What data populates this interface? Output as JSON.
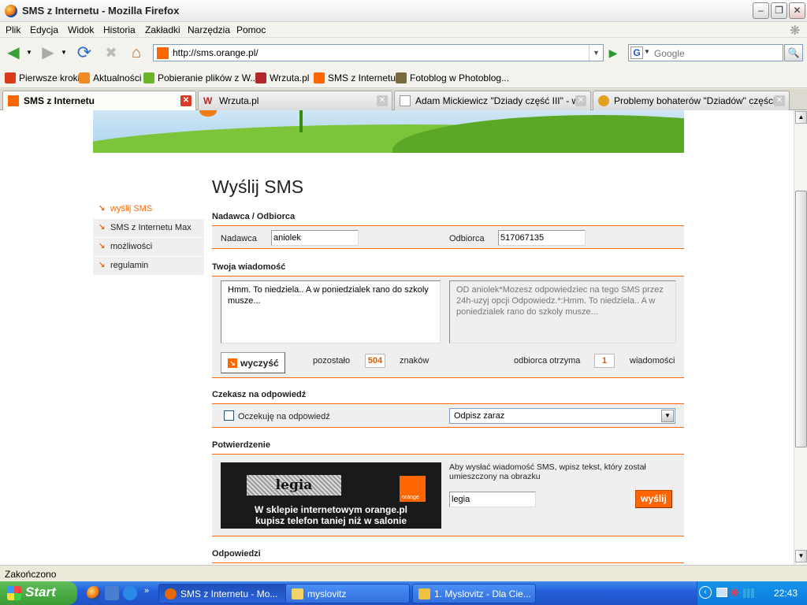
{
  "window": {
    "title": "SMS z Internetu - Mozilla Firefox"
  },
  "menu": [
    "Plik",
    "Edycja",
    "Widok",
    "Historia",
    "Zakładki",
    "Narzędzia",
    "Pomoc"
  ],
  "nav": {
    "url": "http://sms.orange.pl/",
    "search_placeholder": "Google"
  },
  "bookmarks": [
    {
      "label": "Pierwsze kroki",
      "icon": "firefox-icon",
      "color": "#d83a1a"
    },
    {
      "label": "Aktualności",
      "icon": "rss-icon",
      "color": "#f08a24"
    },
    {
      "label": "Pobieranie plików z W...",
      "icon": "download-icon",
      "color": "#6ab42a"
    },
    {
      "label": "Wrzuta.pl",
      "icon": "wrzuta-icon",
      "color": "#b0282a"
    },
    {
      "label": "SMS z Internetu",
      "icon": "orange-icon",
      "color": "#ff6600"
    },
    {
      "label": "Fotoblog w Photoblog...",
      "icon": "photoblog-icon",
      "color": "#7a6a40"
    }
  ],
  "tabs": [
    {
      "label": "SMS z Internetu",
      "active": true
    },
    {
      "label": "Wrzuta.pl",
      "active": false
    },
    {
      "label": "Adam Mickiewicz \"Dziady część III\" - w...",
      "active": false
    },
    {
      "label": "Problemy bohaterów \"Dziadów\" części ...",
      "active": false
    }
  ],
  "page": {
    "title": "Wyślij SMS",
    "sidebar": [
      "wyślij SMS",
      "SMS z Internetu Max",
      "możliwości",
      "regulamin"
    ],
    "section1": {
      "heading": "Nadawca / Odbiorca",
      "sender_label": "Nadawca",
      "sender_value": "aniolek",
      "recipient_label": "Odbiorca",
      "recipient_value": "517067135"
    },
    "section2": {
      "heading": "Twoja wiadomość",
      "message": "Hmm. To niedziela.. A w poniedzialek rano do szkoly musze...",
      "preview": "OD aniolek*Mozesz odpowiedziec na tego SMS przez 24h-uzyj opcji Odpowiedz.*:Hmm. To niedziela.. A w poniedzialek rano do szkoly musze...",
      "clear_label": "wyczyść",
      "remaining_label": "pozostało",
      "remaining_value": "504",
      "chars_label": "znaków",
      "receives_label": "odbiorca otrzyma",
      "receives_value": "1",
      "messages_label": "wiadomości"
    },
    "section3": {
      "heading": "Czekasz na odpowiedź",
      "checkbox_label": "Oczekuję na odpowiedź",
      "select_value": "Odpisz zaraz"
    },
    "section4": {
      "heading": "Potwierdzenie",
      "captcha_word": "legia",
      "logo_text": "orange",
      "promo_line1": "W sklepie internetowym orange.pl",
      "promo_line2": "kupisz telefon taniej niż w salonie",
      "instruction": "Aby wysłać wiadomość SMS, wpisz tekst, który został umieszczony na obrazku",
      "code_value": "legia",
      "send_label": "wyślij"
    },
    "section5": {
      "heading": "Odpowiedzi"
    }
  },
  "status": "Zakończono",
  "taskbar": {
    "start": "Start",
    "tasks": [
      {
        "label": "SMS z Internetu - Mo...",
        "active": true
      },
      {
        "label": "myslovitz",
        "active": false
      },
      {
        "label": "1. Myslovitz - Dla Cie...",
        "active": false
      }
    ],
    "clock": "22:43"
  }
}
